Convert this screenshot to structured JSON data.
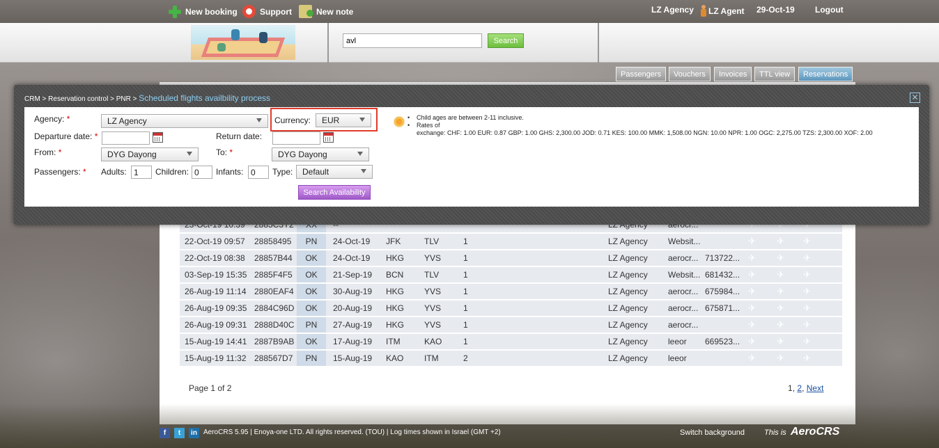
{
  "topbar": {
    "new_booking": "New booking",
    "support": "Support",
    "new_note": "New note",
    "agency": "LZ Agency",
    "agent": "LZ Agent",
    "date": "29-Oct-19",
    "logout": "Logout"
  },
  "header": {
    "search_value": "avl",
    "search_button": "Search"
  },
  "tabs": [
    "Passengers",
    "Vouchers",
    "Invoices",
    "TTL view",
    "Reservations"
  ],
  "modal": {
    "breadcrumb": "CRM > Reservation control > PNR >",
    "title": "Scheduled flights availbility process",
    "close": "✕",
    "agency_label": "Agency:",
    "agency_value": "LZ Agency",
    "currency_label": "Currency:",
    "currency_value": "EUR",
    "departure_label": "Departure date:",
    "return_label": "Return date:",
    "from_label": "From:",
    "from_value": "DYG  Dayong",
    "to_label": "To:",
    "to_value": "DYG  Dayong",
    "passengers_label": "Passengers:",
    "adults_label": "Adults:",
    "adults_value": "1",
    "children_label": "Children:",
    "children_value": "0",
    "infants_label": "Infants:",
    "infants_value": "0",
    "type_label": "Type:",
    "type_value": "Default",
    "search_button": "Search Availability",
    "required_mark": "*",
    "info": {
      "child_ages": "Child ages are between 2-11 inclusive.",
      "rates_label": "Rates of",
      "rates": "exchange: CHF: 1.00  EUR: 0.87  GBP: 1.00  GHS: 2,300.00  JOD: 0.71  KES: 100.00  MMK: 1,508.00  NGN: 10.00  NPR: 1.00  OGC: 2,275.00  TZS: 2,300.00  XOF: 2.00"
    }
  },
  "reservations": {
    "rows": [
      {
        "created": "23-Oct-19 10:39",
        "pnr": "2885C3Y2",
        "status": "XX",
        "date": "--",
        "from": "",
        "to": "",
        "pax": "",
        "agency": "LZ Agency",
        "source": "aerocr...",
        "ref": ""
      },
      {
        "created": "22-Oct-19 09:57",
        "pnr": "28858495",
        "status": "PN",
        "date": "24-Oct-19",
        "from": "JFK",
        "to": "TLV",
        "pax": "1",
        "agency": "LZ Agency",
        "source": "Websit...",
        "ref": ""
      },
      {
        "created": "22-Oct-19 08:38",
        "pnr": "28857B44",
        "status": "OK",
        "date": "24-Oct-19",
        "from": "HKG",
        "to": "YVS",
        "pax": "1",
        "agency": "LZ Agency",
        "source": "aerocr...",
        "ref": "713722..."
      },
      {
        "created": "03-Sep-19 15:35",
        "pnr": "2885F4F5",
        "status": "OK",
        "date": "21-Sep-19",
        "from": "BCN",
        "to": "TLV",
        "pax": "1",
        "agency": "LZ Agency",
        "source": "Websit...",
        "ref": "681432..."
      },
      {
        "created": "26-Aug-19 11:14",
        "pnr": "2880EAF4",
        "status": "OK",
        "date": "30-Aug-19",
        "from": "HKG",
        "to": "YVS",
        "pax": "1",
        "agency": "LZ Agency",
        "source": "aerocr...",
        "ref": "675984..."
      },
      {
        "created": "26-Aug-19 09:35",
        "pnr": "2884C96D",
        "status": "OK",
        "date": "20-Aug-19",
        "from": "HKG",
        "to": "YVS",
        "pax": "1",
        "agency": "LZ Agency",
        "source": "aerocr...",
        "ref": "675871..."
      },
      {
        "created": "26-Aug-19 09:31",
        "pnr": "2888D40C",
        "status": "PN",
        "date": "27-Aug-19",
        "from": "HKG",
        "to": "YVS",
        "pax": "1",
        "agency": "LZ Agency",
        "source": "aerocr...",
        "ref": ""
      },
      {
        "created": "15-Aug-19 14:41",
        "pnr": "2887B9AB",
        "status": "OK",
        "date": "17-Aug-19",
        "from": "ITM",
        "to": "KAO",
        "pax": "1",
        "agency": "LZ Agency",
        "source": "leeor",
        "ref": "669523..."
      },
      {
        "created": "15-Aug-19 11:32",
        "pnr": "288567D7",
        "status": "PN",
        "date": "15-Aug-19",
        "from": "KAO",
        "to": "ITM",
        "pax": "2",
        "agency": "LZ Agency",
        "source": "leeor",
        "ref": ""
      }
    ],
    "page_info": "Page 1 of 2",
    "pages": {
      "p1": "1",
      "sep": ",",
      "p2": "2",
      "next": "Next"
    }
  },
  "footer": {
    "copyright": "AeroCRS 5.95  | Enoya-one LTD. All rights reserved. (TOU) | Log times shown in Israel (GMT +2)",
    "switch_background": "Switch background",
    "this_is": "This is",
    "brand": "AeroCRS"
  },
  "colors": {
    "required": "#d40000",
    "highlight_box": "#e03a2a",
    "search_green": "#6cbf3f",
    "search_availability": "#a05ac8",
    "active_tab": "#5f98bd"
  }
}
